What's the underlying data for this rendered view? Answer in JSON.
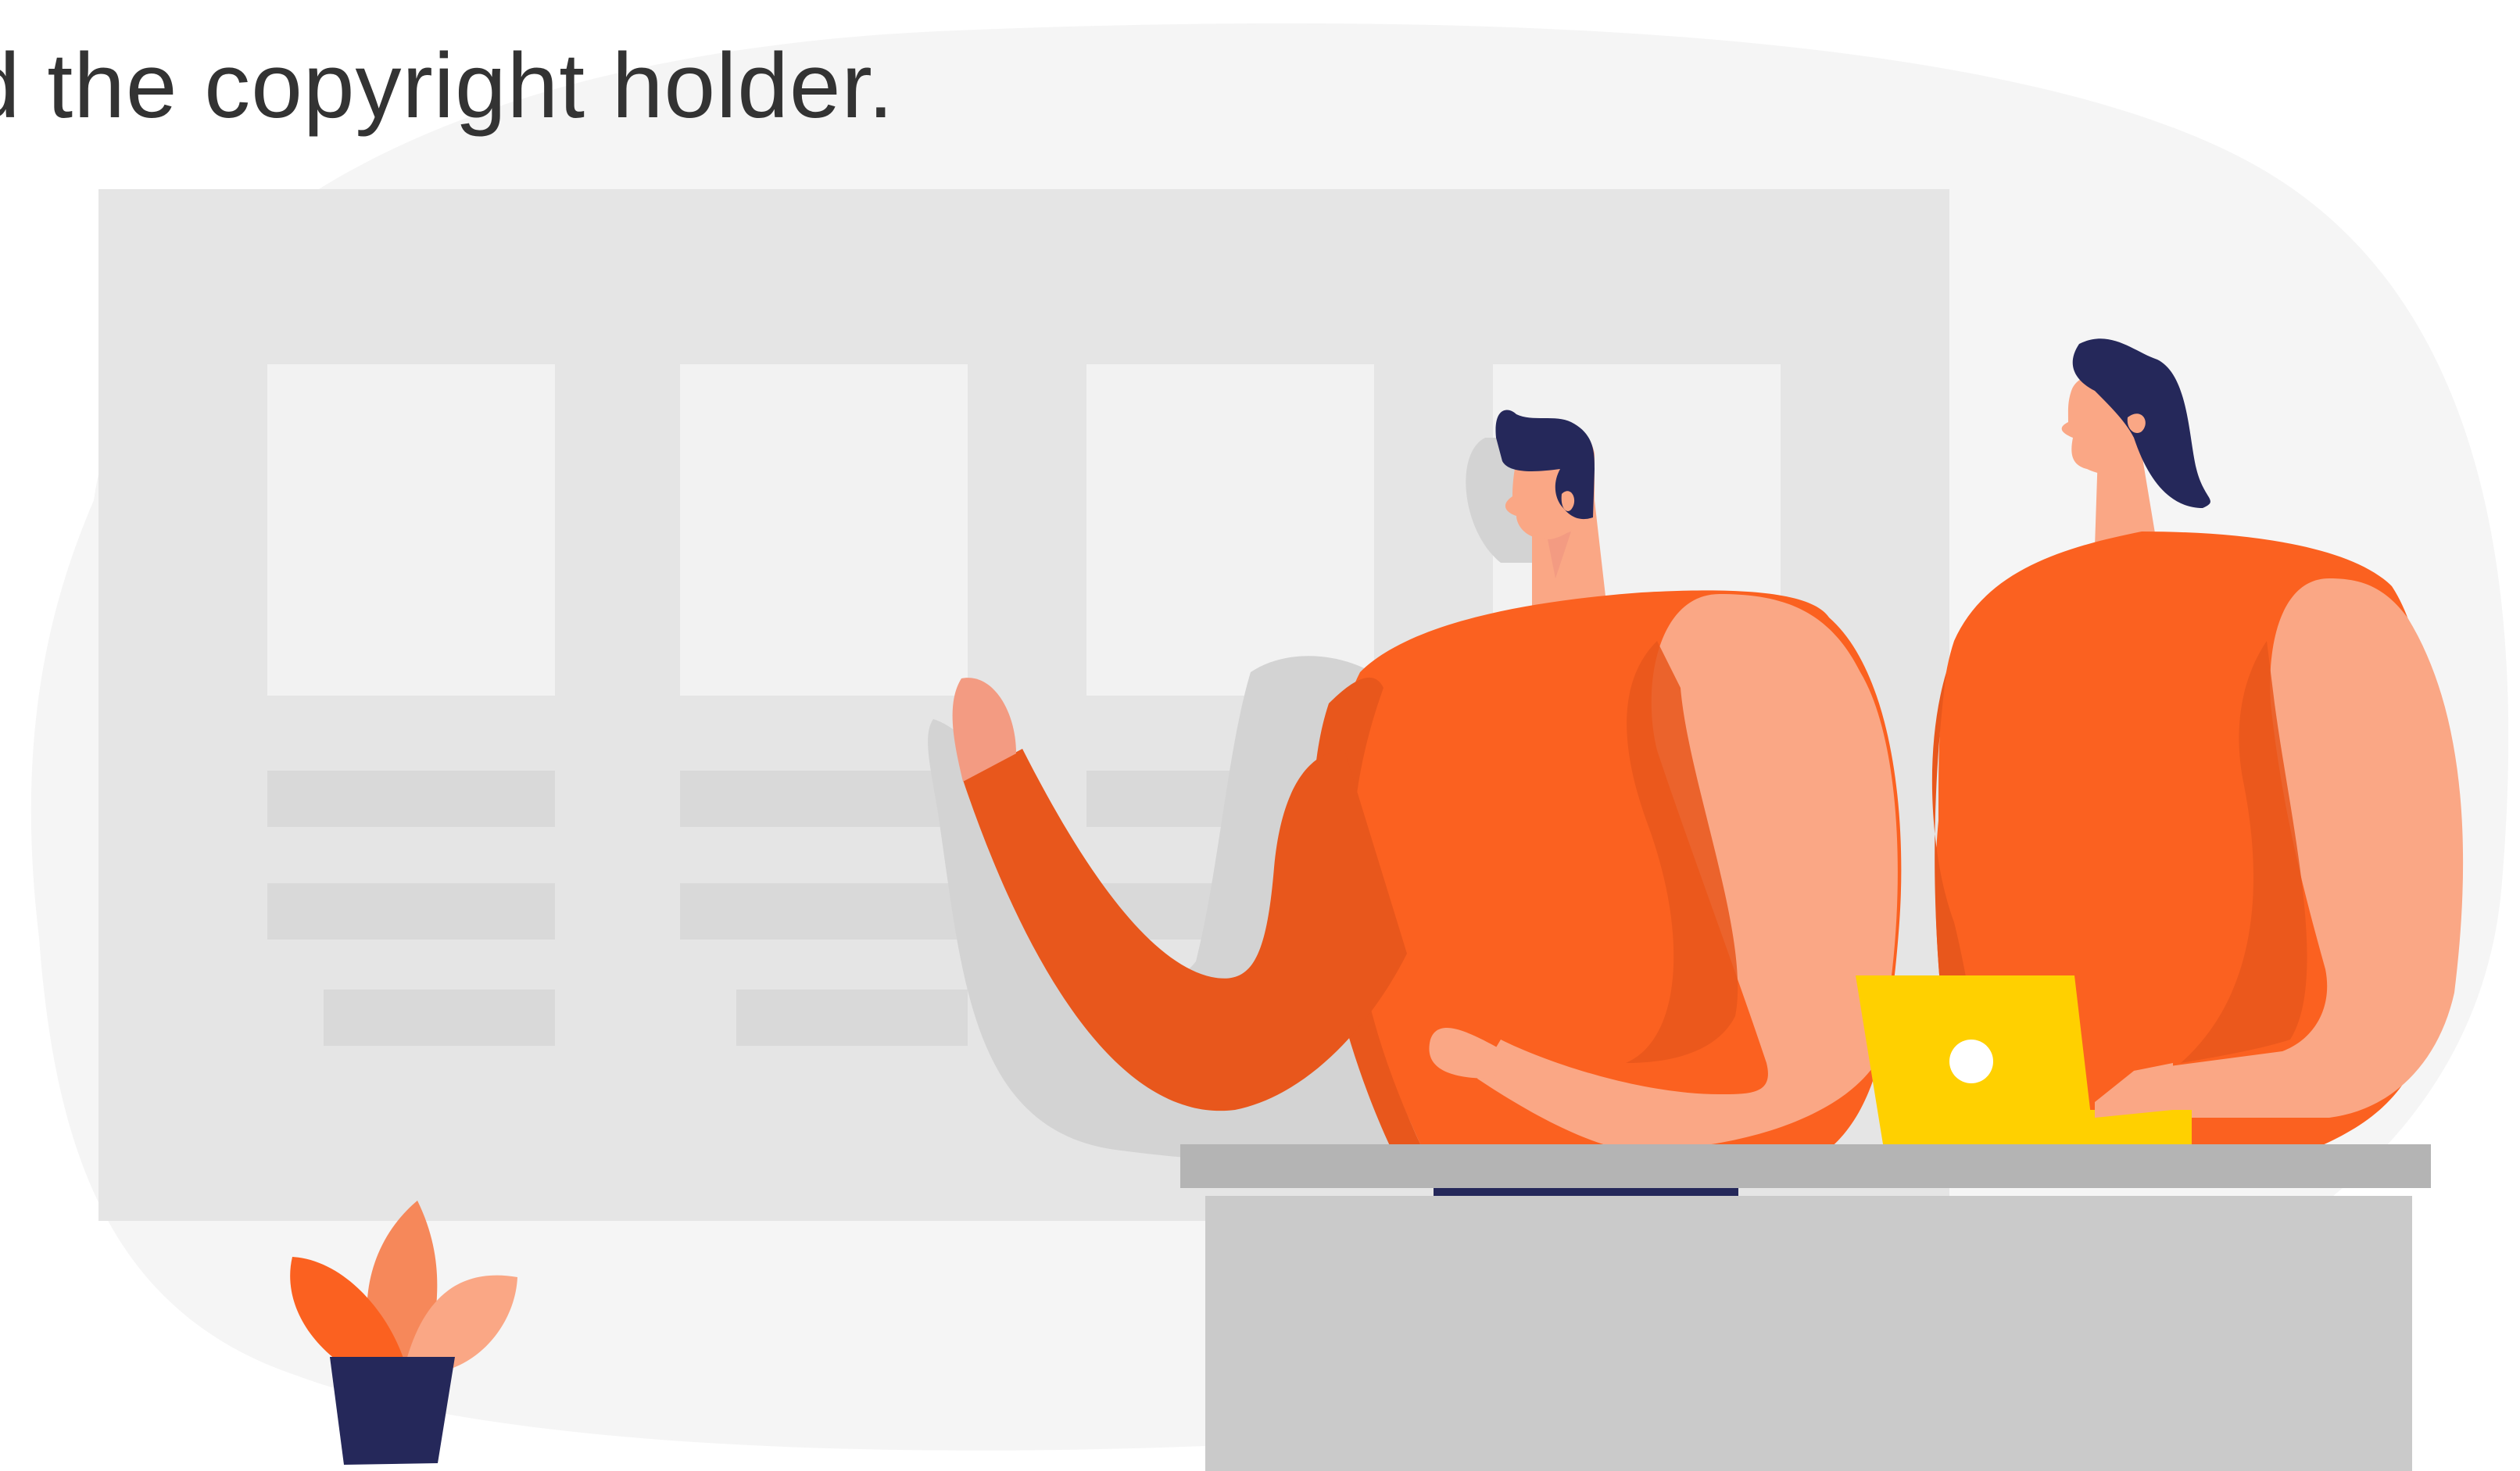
{
  "caption": {
    "text": "d the copyright holder."
  },
  "colors": {
    "background": "#ffffff",
    "blob": "#f5f5f5",
    "board": "#e5e5e5",
    "card": "#f2f2f2",
    "text_line": "#d9d9d9",
    "shadow": "#d3d3d3",
    "orange": "#fb6120",
    "orange_dark": "#e8571c",
    "skin": "#faa785",
    "skin_dark": "#f39b82",
    "hair": "#25285a",
    "laptop": "#ffd000",
    "desk_top": "#b4b4b4",
    "desk": "#cacaca",
    "pot": "#25285a",
    "leaf_orange": "#fb6120",
    "leaf_light": "#faa785",
    "leaf_mid": "#f6885a",
    "caption_text": "#333333"
  },
  "icons": {
    "people": "two-people-icon",
    "plant": "potted-plant-icon",
    "laptop": "laptop-icon"
  }
}
